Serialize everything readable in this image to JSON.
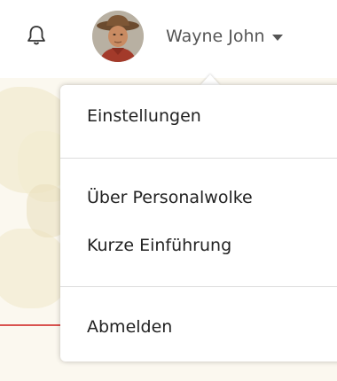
{
  "header": {
    "notifications_icon": "bell-icon",
    "user": {
      "name": "Wayne John",
      "avatar_icon": "user-avatar-icon",
      "caret_icon": "caret-down-icon"
    }
  },
  "menu": {
    "items": [
      {
        "label": "Einstellungen"
      },
      {
        "label": "Über Personalwolke"
      },
      {
        "label": "Kurze Einführung"
      },
      {
        "label": "Abmelden"
      }
    ]
  },
  "colors": {
    "text": "#222222",
    "header_text": "#555555",
    "divider": "#dddddd",
    "map_line": "#d9534f"
  }
}
